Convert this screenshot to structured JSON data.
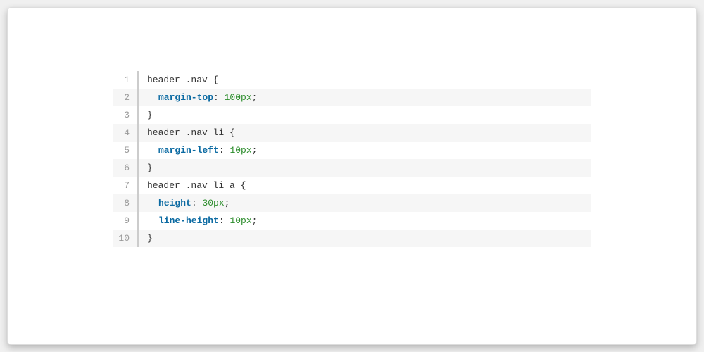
{
  "code": {
    "language": "css",
    "lines": [
      {
        "n": "1",
        "tokens": [
          {
            "t": "header .nav {",
            "c": "tok-punct"
          }
        ]
      },
      {
        "n": "2",
        "tokens": [
          {
            "t": "  ",
            "c": "indent"
          },
          {
            "t": "margin-top",
            "c": "tok-prop"
          },
          {
            "t": ": ",
            "c": "tok-punct"
          },
          {
            "t": "100px",
            "c": "tok-value"
          },
          {
            "t": ";",
            "c": "tok-punct"
          }
        ]
      },
      {
        "n": "3",
        "tokens": [
          {
            "t": "}",
            "c": "tok-punct"
          }
        ]
      },
      {
        "n": "4",
        "tokens": [
          {
            "t": "header .nav li {",
            "c": "tok-punct"
          }
        ]
      },
      {
        "n": "5",
        "tokens": [
          {
            "t": "  ",
            "c": "indent"
          },
          {
            "t": "margin-left",
            "c": "tok-prop"
          },
          {
            "t": ": ",
            "c": "tok-punct"
          },
          {
            "t": "10px",
            "c": "tok-value"
          },
          {
            "t": ";",
            "c": "tok-punct"
          }
        ]
      },
      {
        "n": "6",
        "tokens": [
          {
            "t": "}",
            "c": "tok-punct"
          }
        ]
      },
      {
        "n": "7",
        "tokens": [
          {
            "t": "header .nav li a {",
            "c": "tok-punct"
          }
        ]
      },
      {
        "n": "8",
        "tokens": [
          {
            "t": "  ",
            "c": "indent"
          },
          {
            "t": "height",
            "c": "tok-prop"
          },
          {
            "t": ": ",
            "c": "tok-punct"
          },
          {
            "t": "30px",
            "c": "tok-value"
          },
          {
            "t": ";",
            "c": "tok-punct"
          }
        ]
      },
      {
        "n": "9",
        "tokens": [
          {
            "t": "  ",
            "c": "indent"
          },
          {
            "t": "line-height",
            "c": "tok-prop"
          },
          {
            "t": ": ",
            "c": "tok-punct"
          },
          {
            "t": "10px",
            "c": "tok-value"
          },
          {
            "t": ";",
            "c": "tok-punct"
          }
        ]
      },
      {
        "n": "10",
        "tokens": [
          {
            "t": "}",
            "c": "tok-punct"
          }
        ]
      }
    ]
  }
}
